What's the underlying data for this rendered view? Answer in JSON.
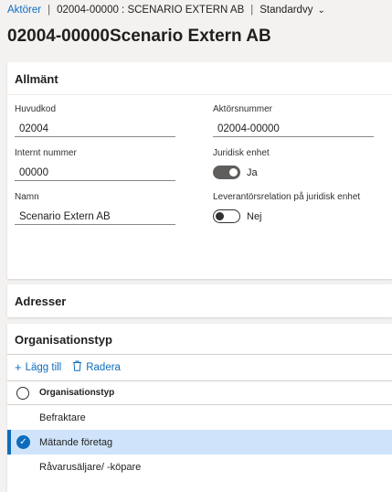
{
  "breadcrumb": {
    "root": "Aktörer",
    "separator": "|",
    "record": "02004-00000 : SCENARIO EXTERN AB",
    "view": "Standardvy"
  },
  "page_title": "02004-00000Scenario Extern AB",
  "general": {
    "title": "Allmänt",
    "main_code": {
      "label": "Huvudkod",
      "value": "02004"
    },
    "internal_number": {
      "label": "Internt nummer",
      "value": "00000"
    },
    "name": {
      "label": "Namn",
      "value": "Scenario Extern AB"
    },
    "actor_number": {
      "label": "Aktörsnummer",
      "value": "02004-00000"
    },
    "legal_entity": {
      "label": "Juridisk enhet",
      "state": "Ja"
    },
    "supplier_relation": {
      "label": "Leverantörsrelation på juridisk enhet",
      "state": "Nej"
    }
  },
  "addresses": {
    "title": "Adresser"
  },
  "org_type": {
    "title": "Organisationstyp",
    "add_label": "Lägg till",
    "delete_label": "Radera",
    "column_header": "Organisationstyp",
    "rows": [
      "Befraktare",
      "Mätande företag",
      "Råvarusäljare/ -köpare"
    ],
    "selected_index": 1
  },
  "colors": {
    "accent": "#0f6cbd",
    "selected_row": "#cfe4fa"
  }
}
